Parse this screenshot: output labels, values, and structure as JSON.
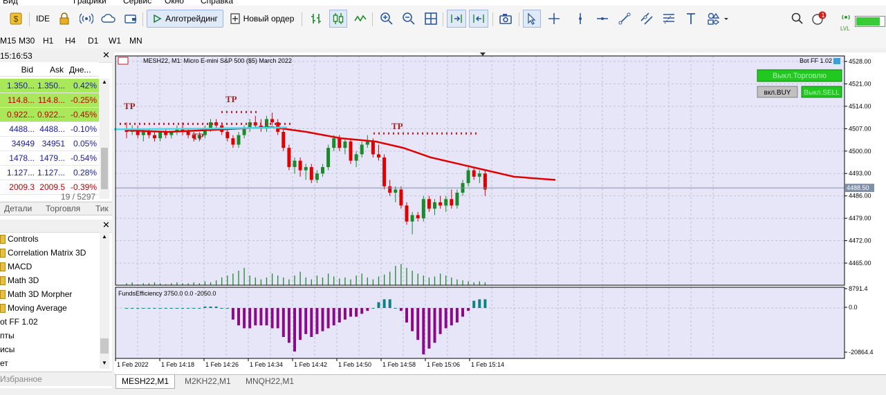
{
  "menu": [
    "Вид",
    "Графики",
    "Сервис",
    "Окно",
    "Справка"
  ],
  "toolbar": {
    "ide_label": "IDE",
    "algo_label": "Алготрейдинг",
    "order_label": "Новый ордер",
    "notifications_count": "1",
    "lvl_label": "LVL"
  },
  "timeframes": [
    "M15",
    "M30",
    "H1",
    "H4",
    "D1",
    "W1",
    "MN"
  ],
  "market_watch": {
    "time": "15:16:53",
    "headers": [
      "Bid",
      "Ask",
      "Дне..."
    ],
    "rows": [
      {
        "bid": "1.350...",
        "ask": "1.350...",
        "change": "0.42%",
        "bg": "#a8e85a",
        "color": "#1a1aa0"
      },
      {
        "bid": "114.8...",
        "ask": "114.8...",
        "change": "-0.25%",
        "bg": "#a8e85a",
        "color": "#c00000"
      },
      {
        "bid": "0.922...",
        "ask": "0.922...",
        "change": "-0.45%",
        "bg": "#a8e85a",
        "color": "#c00000"
      },
      {
        "bid": "4488...",
        "ask": "4488...",
        "change": "-0.10%",
        "bg": "#ffffff",
        "color": "#1a1aa0"
      },
      {
        "bid": "34949",
        "ask": "34951",
        "change": "0.05%",
        "bg": "#ffffff",
        "color": "#1a1aa0"
      },
      {
        "bid": "1478...",
        "ask": "1479...",
        "change": "-0.54%",
        "bg": "#ffffff",
        "color": "#1a1aa0"
      },
      {
        "bid": "1.127...",
        "ask": "1.127...",
        "change": "0.28%",
        "bg": "#ffffff",
        "color": "#1a1aa0"
      },
      {
        "bid": "2009.3",
        "ask": "2009.5",
        "change": "-0.39%",
        "bg": "#ffffff",
        "color": "#c00000"
      }
    ],
    "counter": "19 / 5297",
    "tabs": [
      "Детали",
      "Торговля",
      "Тик"
    ]
  },
  "navigator": {
    "items": [
      "Controls",
      "Correlation Matrix 3D",
      "MACD",
      "Math 3D",
      "Math 3D Morpher",
      "Moving Average"
    ],
    "extra": [
      "ot FF 1.02",
      "пты",
      "исы",
      "ет"
    ],
    "favorites": "Избранное"
  },
  "chart": {
    "title": "MESH22, M1:  Micro E-mini S&P 500 ($5) March 2022",
    "ea_label": "Bot FF 1.02",
    "btn_trading": "Выкл.Торговлю",
    "btn_buy": "вкл.BUY",
    "btn_sell": "Выкл.SELL",
    "indicator_label": "FundsEfficiency 3750.0 0.0 -2050.0",
    "current_price": "4488.50",
    "tp_label": "TP",
    "price_ticks": [
      "4528.00",
      "4521.00",
      "4514.00",
      "4507.00",
      "4500.00",
      "4493.00",
      "4486.00",
      "4479.00",
      "4472.00",
      "4465.00"
    ],
    "ind_ticks": [
      "8791.4",
      "0.0",
      "-20864.4"
    ],
    "time_ticks": [
      "1 Feb 2022",
      "1 Feb 14:18",
      "1 Feb 14:26",
      "1 Feb 14:34",
      "1 Feb 14:42",
      "1 Feb 14:50",
      "1 Feb 14:58",
      "1 Feb 15:06",
      "1 Feb 15:14"
    ],
    "colors": {
      "bull": "#1a8a2a",
      "bear": "#e00000",
      "ma": "#e00000",
      "bg": "#e6e6f8",
      "grid": "#c0c0d8",
      "ind": "#8b0a8b",
      "ind_pos": "#108080"
    }
  },
  "chart_tabs": [
    "MESH22,M1",
    "M2KH22,M1",
    "MNQH22,M1"
  ]
}
